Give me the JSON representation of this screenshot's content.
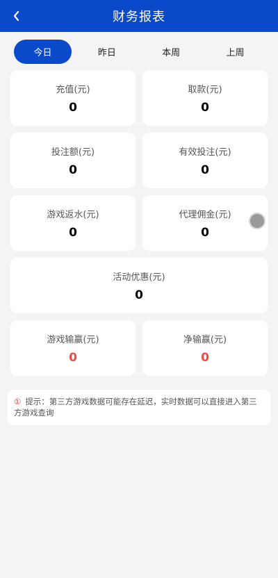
{
  "header": {
    "title": "财务报表"
  },
  "tabs": [
    {
      "label": "今日",
      "active": true
    },
    {
      "label": "昨日",
      "active": false
    },
    {
      "label": "本周",
      "active": false
    },
    {
      "label": "上周",
      "active": false
    }
  ],
  "cards": {
    "recharge": {
      "label": "充值(元)",
      "value": "0"
    },
    "withdraw": {
      "label": "取款(元)",
      "value": "0"
    },
    "bet_amount": {
      "label": "投注额(元)",
      "value": "0"
    },
    "valid_bet": {
      "label": "有效投注(元)",
      "value": "0"
    },
    "game_rebate": {
      "label": "游戏返水(元)",
      "value": "0"
    },
    "agent_commission": {
      "label": "代理佣金(元)",
      "value": "0"
    },
    "promotion": {
      "label": "活动优惠(元)",
      "value": "0"
    },
    "game_winloss": {
      "label": "游戏输赢(元)",
      "value": "0"
    },
    "net_winloss": {
      "label": "净输赢(元)",
      "value": "0"
    }
  },
  "tip": {
    "icon": "①",
    "text": "提示：第三方游戏数据可能存在延迟，实时数据可以直接进入第三方游戏查询"
  },
  "colors": {
    "primary": "#0a49c9",
    "negative": "#f04a4a",
    "background": "#f4f4f4"
  }
}
